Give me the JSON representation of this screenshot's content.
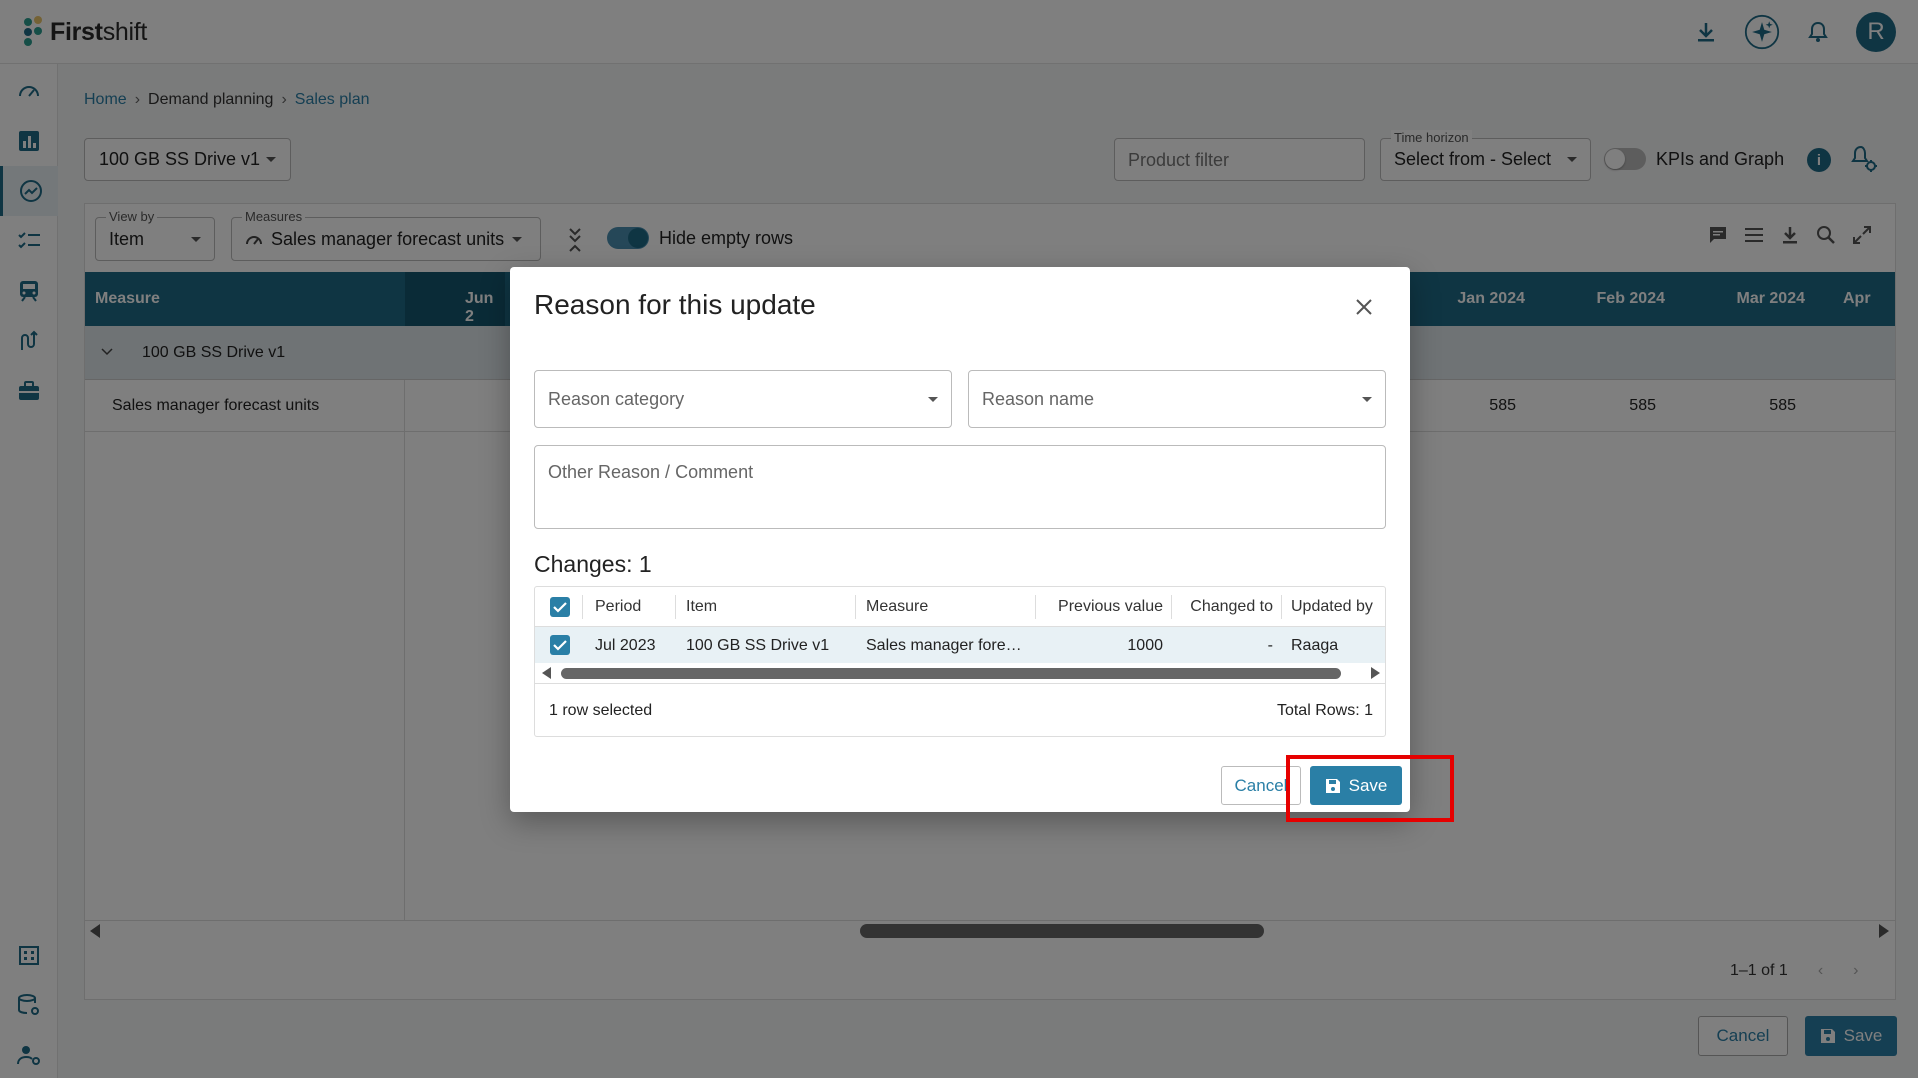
{
  "app": {
    "logo_first": "First",
    "logo_second": "shift",
    "avatar_initial": "R"
  },
  "breadcrumb": {
    "home": "Home",
    "sep": "›",
    "section": "Demand planning",
    "current": "Sales plan"
  },
  "toolbar": {
    "item_selected": "100 GB SS Drive v1",
    "product_filter_placeholder": "Product filter",
    "time_horizon_label": "Time horizon",
    "time_horizon_value": "Select from - Select",
    "kpis_label": "KPIs and Graph"
  },
  "grid": {
    "view_by_label": "View by",
    "view_by_value": "Item",
    "measures_label": "Measures",
    "measures_value": "Sales manager forecast units",
    "hide_empty_label": "Hide empty rows",
    "header_measure": "Measure",
    "header_jun": "Jun 2",
    "months": [
      "Jan 2024",
      "Feb 2024",
      "Mar 2024",
      "Apr"
    ],
    "group_row": "100 GB SS Drive v1",
    "measure_row": "Sales manager forecast units",
    "values": [
      "585",
      "585",
      "585"
    ],
    "pager": "1–1 of 1"
  },
  "footer": {
    "cancel": "Cancel",
    "save": "Save"
  },
  "modal": {
    "title": "Reason for this update",
    "reason_category": "Reason category",
    "reason_name": "Reason name",
    "comment_placeholder": "Other Reason / Comment",
    "changes_title": "Changes: 1",
    "columns": [
      "Period",
      "Item",
      "Measure",
      "Previous value",
      "Changed to",
      "Updated by"
    ],
    "row": {
      "period": "Jul 2023",
      "item": "100 GB SS Drive v1",
      "measure": "Sales manager fore…",
      "previous": "1000",
      "changed_to": "-",
      "updated_by": "Raaga"
    },
    "selected_text": "1 row selected",
    "total_rows": "Total Rows: 1",
    "cancel": "Cancel",
    "save": "Save"
  },
  "colors": {
    "primary": "#1f6a87",
    "accent": "#2a7fa6",
    "highlight": "#e60000"
  }
}
